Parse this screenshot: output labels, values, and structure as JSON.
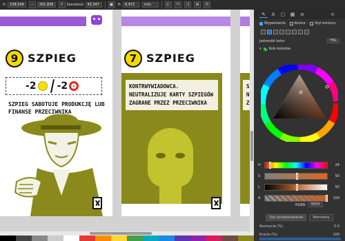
{
  "toolbar": {
    "x_label": "X:",
    "x_value": "108,544",
    "y_value": "201,836",
    "w_label": "Szerokość",
    "w_value": "45,347",
    "h_label": "H:",
    "h_value": "8,472",
    "unit": "mm"
  },
  "cards": [
    {
      "number": "9",
      "title": "SZPIEG",
      "cost_left": "-2",
      "cost_right": "-2",
      "description": "SZPIEG SABOTUJE PRODUKCJĘ LUB FINANSE PRZECIWNIKA"
    },
    {
      "number": "7",
      "title": "SZPIEG",
      "description": "KONTRWYWIADOWCA. NEUTRALIZUJE KARTY SZPIEGÓW ZAGRANE PRZEZ PRZECIWNIKA"
    },
    {
      "description_partial": "S\nN\nZ"
    }
  ],
  "panel": {
    "tabs": [
      "fill-stroke",
      "text",
      "objects",
      "swatches",
      "layers"
    ],
    "fill_label": "Wypełnienie",
    "stroke_label": "Kontur",
    "stroke_style_label": "Styl konturu",
    "color_units_label": "Jednostki kolor",
    "color_units_value": "HSL",
    "wheel_section_label": "Koło kolorów",
    "sliders": [
      {
        "label": "H",
        "value": "24"
      },
      {
        "label": "S",
        "value": "50"
      },
      {
        "label": "L",
        "value": "50"
      },
      {
        "label": "A",
        "value": "100"
      }
    ],
    "rgba_label": "RGBA:",
    "rgba_value": "9555",
    "bottom_tabs": [
      "Styl przedstawiania",
      "Normalny"
    ],
    "props": [
      {
        "label": "Rozmycie (%)",
        "value": "0.0"
      },
      {
        "label": "Krycie (%)",
        "value": "100"
      }
    ]
  },
  "accent_colors": {
    "card_purple": "#9b59d6",
    "olive": "#8a8a1c",
    "yellow": "#f4d800"
  }
}
